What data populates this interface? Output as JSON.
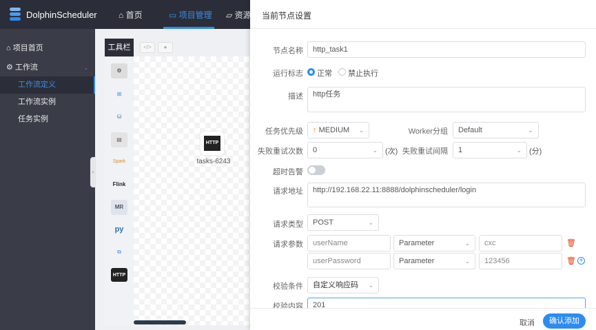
{
  "header": {
    "app_name": "DolphinScheduler",
    "nav": [
      {
        "label": "首页",
        "icon": "home-icon"
      },
      {
        "label": "项目管理",
        "icon": "folder-project-icon"
      },
      {
        "label": "资源",
        "icon": "folder-icon"
      }
    ]
  },
  "sidebar": {
    "items": [
      {
        "label": "项目首页",
        "icon": "home-icon"
      },
      {
        "label": "工作流",
        "icon": "gear-icon"
      },
      {
        "label": "工作流定义"
      },
      {
        "label": "工作流实例"
      },
      {
        "label": "任务实例"
      }
    ]
  },
  "canvas": {
    "toolbar_title": "工具栏",
    "code_btn": "</>",
    "node_label": "tasks-6243",
    "node_icon_text": "HTTP",
    "tools": [
      "shell",
      "sub_process",
      "procedure",
      "sql",
      "spark",
      "Flink",
      "MR",
      "python",
      "dependent",
      "HTTP"
    ]
  },
  "drawer": {
    "title": "当前节点设置",
    "node_name": {
      "label": "节点名称",
      "value": "http_task1"
    },
    "run_flag": {
      "label": "运行标志",
      "options": [
        "正常",
        "禁止执行"
      ],
      "selected": "正常"
    },
    "description": {
      "label": "描述",
      "value": "http任务"
    },
    "priority": {
      "label": "任务优先级",
      "value": "MEDIUM"
    },
    "worker_group": {
      "label": "Worker分组",
      "value": "Default"
    },
    "retry_times": {
      "label": "失败重试次数",
      "value": "0",
      "unit": "(次)"
    },
    "retry_interval": {
      "label": "失败重试间隔",
      "value": "1",
      "unit": "(分)"
    },
    "timeout_alarm": {
      "label": "超时告警",
      "enabled": false
    },
    "url": {
      "label": "请求地址",
      "value": "http://192.168.22.11:8888/dolphinscheduler/login"
    },
    "method": {
      "label": "请求类型",
      "value": "POST"
    },
    "params": {
      "label": "请求参数",
      "rows": [
        {
          "name": "userName",
          "type": "Parameter",
          "value": "cxc"
        },
        {
          "name": "userPassword",
          "type": "Parameter",
          "value": "123456"
        }
      ]
    },
    "check_condition": {
      "label": "校验条件",
      "value": "自定义响应码"
    },
    "check_content": {
      "label": "校验内容",
      "value": "201"
    },
    "cancel_label": "取消",
    "confirm_label": "确认添加"
  },
  "colors": {
    "accent": "#2d8cf0",
    "header_bg": "#2b2e38",
    "sidebar_bg": "#3a3d48",
    "priority_arrow": "#f08a24",
    "delete": "#ed4014"
  }
}
